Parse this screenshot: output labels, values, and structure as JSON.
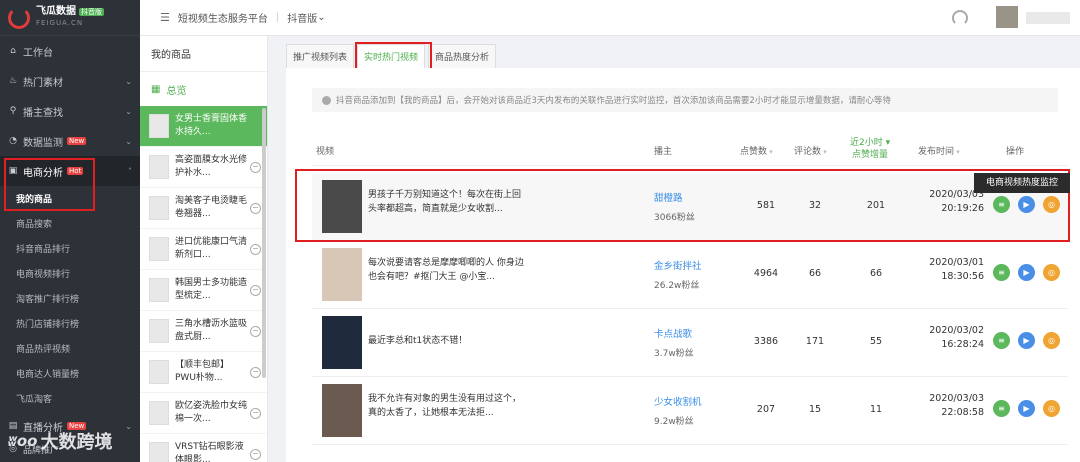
{
  "logo": {
    "name": "飞瓜数据",
    "sub": "FEIGUA.CN",
    "tag": "抖音版"
  },
  "nav": [
    {
      "label": "工作台",
      "icon": "home-icon"
    },
    {
      "label": "热门素材",
      "icon": "fire-icon",
      "caret": "⌄"
    },
    {
      "label": "播主查找",
      "icon": "search-icon",
      "caret": "⌄"
    },
    {
      "label": "数据监测",
      "icon": "monitor-icon",
      "caret": "⌄",
      "badge": "New"
    },
    {
      "label": "电商分析",
      "icon": "shop-icon",
      "caret": "˄",
      "badge": "Hot"
    }
  ],
  "subnav": [
    "我的商品",
    "商品搜索",
    "抖音商品排行",
    "电商视频排行",
    "淘客推广排行榜",
    "热门店铺排行榜",
    "商品热评视频",
    "电商达人销量榜",
    "飞瓜淘客"
  ],
  "nav_bottom": {
    "label": "直播分析",
    "badge": "New",
    "extra": "品牌推广"
  },
  "topbar": {
    "title": "短视频生态服务平台",
    "version": "抖音版"
  },
  "products": {
    "header": "我的商品",
    "all": "总览",
    "items": [
      "女男士香膏固体香水持久...",
      "高姿面膜女水光修护补水...",
      "淘美客子电烫睫毛卷翘器...",
      "进口优能康口气清新剂口...",
      "韩国男士多功能造型梳定...",
      "三角水槽沥水篮吸盘式厨...",
      "【顺丰包邮】PWU朴物...",
      "欧亿姿洗脸巾女纯棉一次...",
      "VRST钻石眼影液体眼影..."
    ]
  },
  "tabs": [
    "推广视频列表",
    "实时热门视频",
    "商品热度分析"
  ],
  "notice": "抖音商品添加到【我的商品】后，会开始对该商品近3天内发布的关联作品进行实时监控，首次添加该商品需要2小时才能显示增量数据，请耐心等待",
  "columns": {
    "video": "视频",
    "anchor": "播主",
    "likes": "点赞数",
    "comments": "评论数",
    "inc1": "近2小时",
    "inc2": "点赞增量",
    "time": "发布时间",
    "ops": "操作"
  },
  "rows": [
    {
      "title": "男孩子千万别知道这个！每次在街上回头率都超高，简直就是少女收割...",
      "anchor": "甜橙路",
      "fans": "3066粉丝",
      "likes": "581",
      "comments": "32",
      "inc": "201",
      "date": "2020/03/03",
      "time": "20:19:26"
    },
    {
      "title": "每次说要请客总是摩摩唧唧的人 你身边也会有吧？#抠门大王 @小宝...",
      "anchor": "金乡街拌社",
      "fans": "26.2w粉丝",
      "likes": "4964",
      "comments": "66",
      "inc": "66",
      "date": "2020/03/01",
      "time": "18:30:56"
    },
    {
      "title": "最近李总和t1状态不错！",
      "anchor": "卡点战歌",
      "fans": "3.7w粉丝",
      "likes": "3386",
      "comments": "171",
      "inc": "55",
      "date": "2020/03/02",
      "time": "16:28:24"
    },
    {
      "title": "我不允许有对象的男生没有用过这个，真的太香了，让她根本无法拒...",
      "anchor": "少女收割机",
      "fans": "9.2w粉丝",
      "likes": "207",
      "comments": "15",
      "inc": "11",
      "date": "2020/03/03",
      "time": "22:08:58"
    }
  ],
  "tooltip": "电商视频热度监控",
  "watermark": "大数跨境"
}
